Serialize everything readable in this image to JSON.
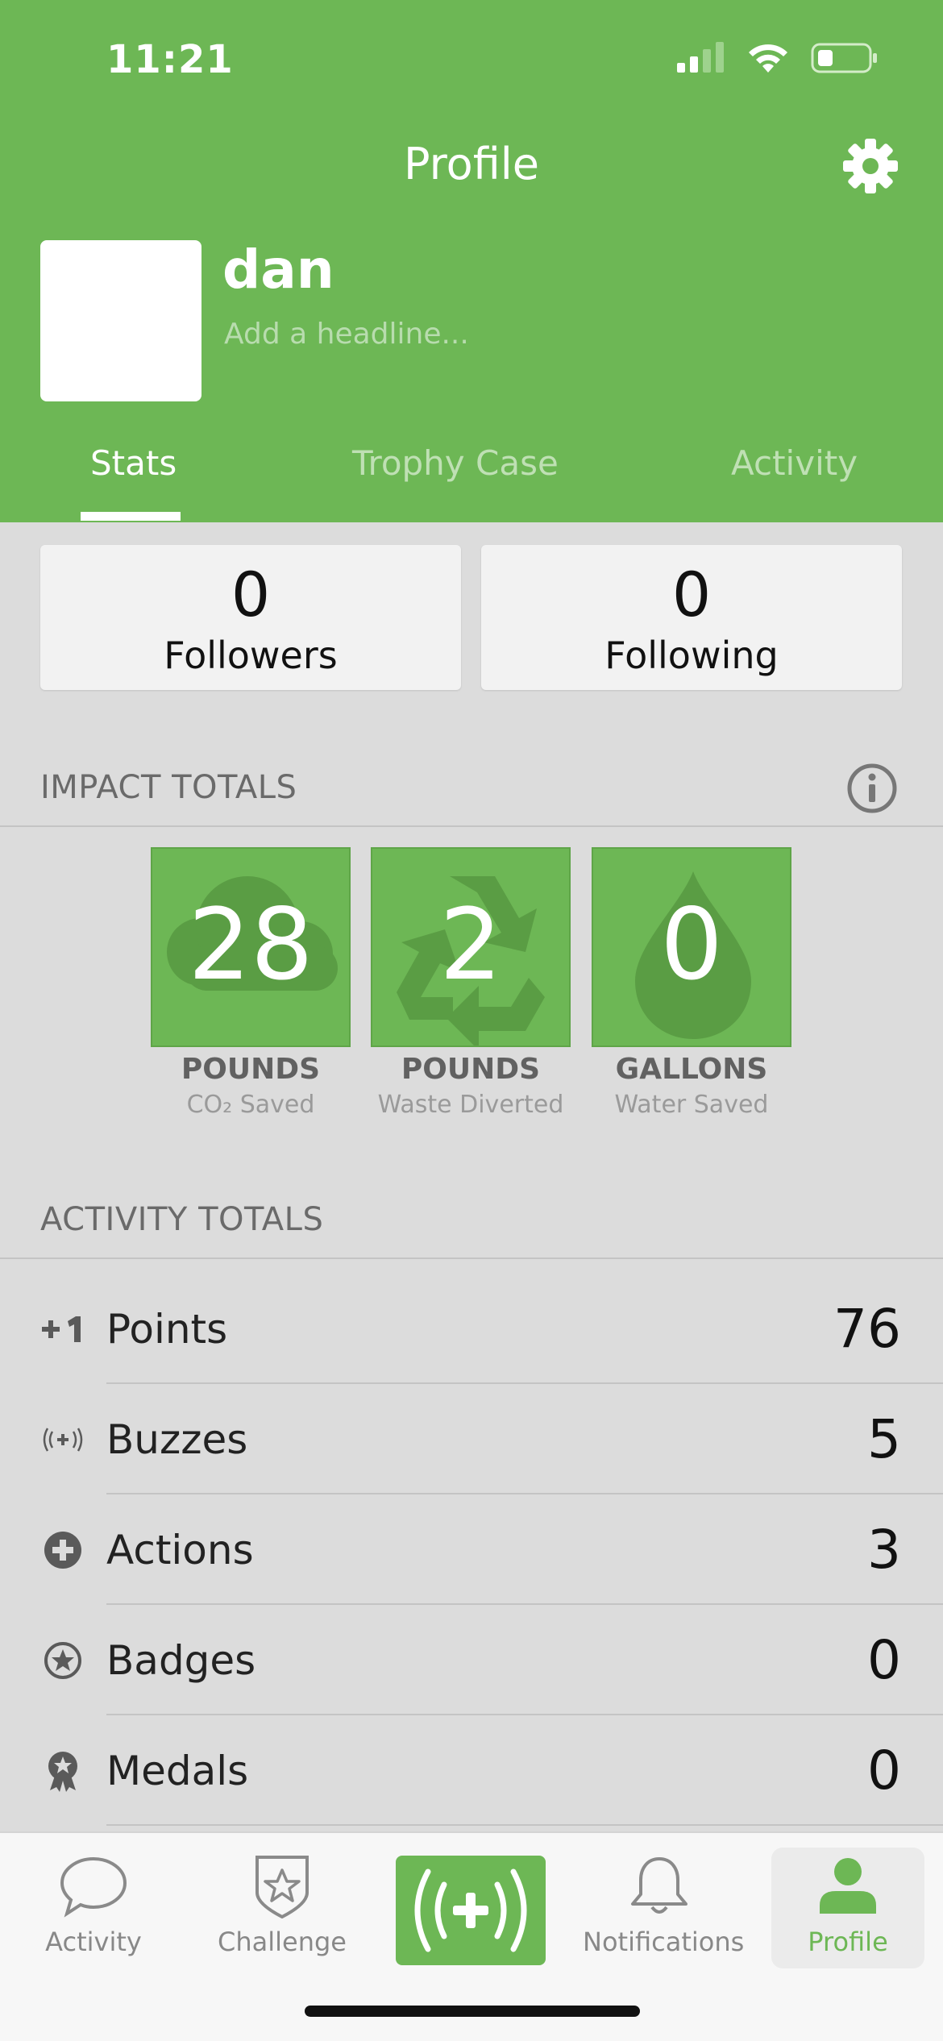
{
  "status_bar": {
    "time": "11:21"
  },
  "header": {
    "title": "Profile",
    "username": "dan",
    "headline_placeholder": "Add a headline...",
    "tabs": [
      {
        "label": "Stats",
        "active": true
      },
      {
        "label": "Trophy Case",
        "active": false
      },
      {
        "label": "Activity",
        "active": false
      }
    ]
  },
  "social": {
    "followers": {
      "count": "0",
      "label": "Followers"
    },
    "following": {
      "count": "0",
      "label": "Following"
    }
  },
  "impact": {
    "title": "IMPACT TOTALS",
    "tiles": [
      {
        "value": "28",
        "unit": "POUNDS",
        "caption": "CO₂ Saved",
        "icon": "cloud-icon"
      },
      {
        "value": "2",
        "unit": "POUNDS",
        "caption": "Waste Diverted",
        "icon": "recycle-icon"
      },
      {
        "value": "0",
        "unit": "GALLONS",
        "caption": "Water Saved",
        "icon": "water-drop-icon"
      }
    ]
  },
  "activity_totals": {
    "title": "ACTIVITY TOTALS",
    "rows": [
      {
        "label": "Points",
        "value": "76",
        "icon": "plus-one-icon"
      },
      {
        "label": "Buzzes",
        "value": "5",
        "icon": "buzz-icon"
      },
      {
        "label": "Actions",
        "value": "3",
        "icon": "plus-circle-icon"
      },
      {
        "label": "Badges",
        "value": "0",
        "icon": "star-badge-icon"
      },
      {
        "label": "Medals",
        "value": "0",
        "icon": "medal-icon"
      }
    ]
  },
  "tabbar": {
    "items": [
      {
        "label": "Activity",
        "icon": "chat-bubble-icon"
      },
      {
        "label": "Challenge",
        "icon": "shield-star-icon"
      },
      {
        "label": "",
        "icon": "buzz-icon"
      },
      {
        "label": "Notifications",
        "icon": "bell-icon"
      },
      {
        "label": "Profile",
        "icon": "person-icon",
        "active": true
      }
    ]
  },
  "colors": {
    "brand_green": "#6db755",
    "background": "#dcdcdc"
  }
}
